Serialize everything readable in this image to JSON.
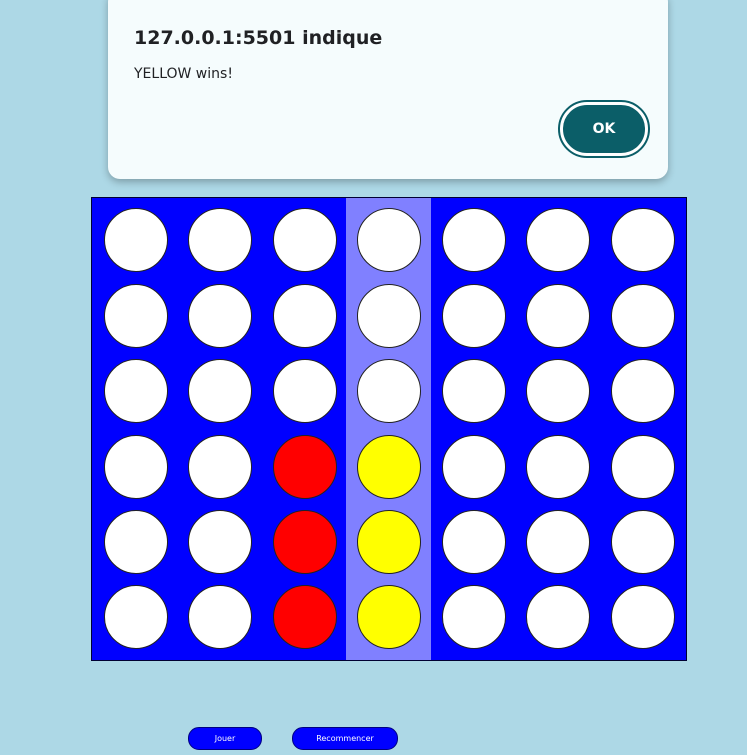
{
  "dialog": {
    "title": "127.0.0.1:5501 indique",
    "message": "YELLOW wins!",
    "ok_label": "OK"
  },
  "board": {
    "rows": 6,
    "columns": 7,
    "highlighted_column": 3,
    "cells": [
      [
        "empty",
        "empty",
        "empty",
        "empty",
        "empty",
        "empty",
        "empty"
      ],
      [
        "empty",
        "empty",
        "empty",
        "empty",
        "empty",
        "empty",
        "empty"
      ],
      [
        "empty",
        "empty",
        "empty",
        "empty",
        "empty",
        "empty",
        "empty"
      ],
      [
        "empty",
        "empty",
        "red",
        "yellow",
        "empty",
        "empty",
        "empty"
      ],
      [
        "empty",
        "empty",
        "red",
        "yellow",
        "empty",
        "empty",
        "empty"
      ],
      [
        "empty",
        "empty",
        "red",
        "yellow",
        "empty",
        "empty",
        "empty"
      ]
    ],
    "colors": {
      "board": "#0000ff",
      "highlight": "#8080ff",
      "empty": "#ffffff",
      "red": "#ff0000",
      "yellow": "#ffff00"
    }
  },
  "controls": {
    "play_label": "Jouer",
    "restart_label": "Recommencer"
  }
}
